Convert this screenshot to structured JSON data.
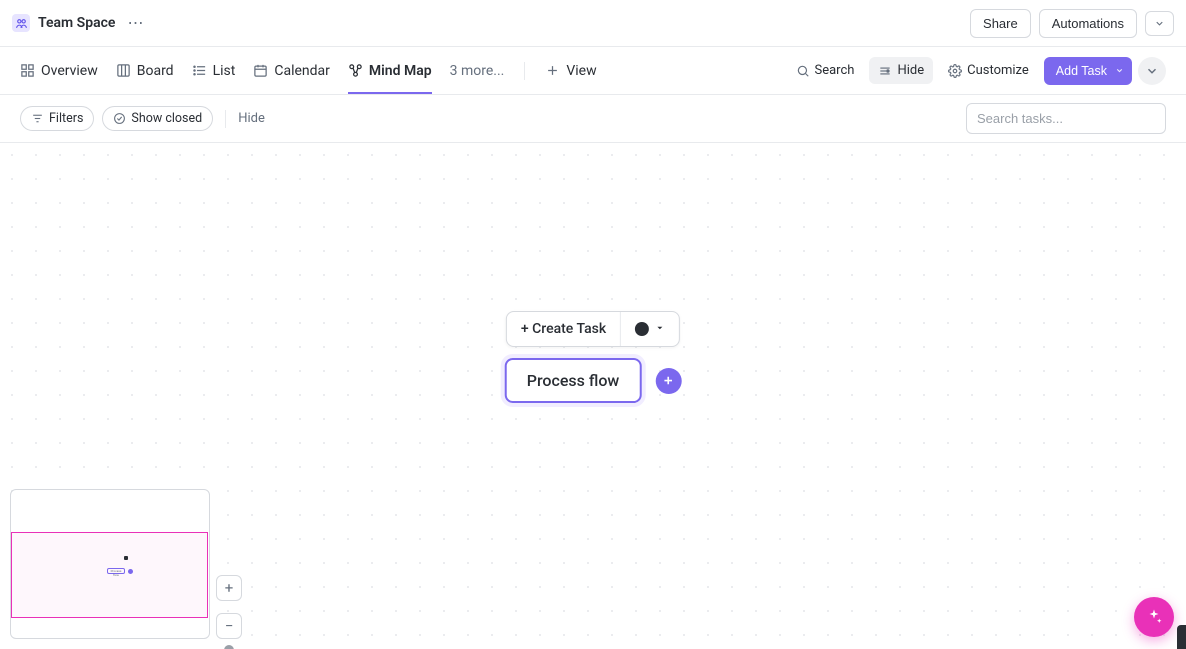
{
  "header": {
    "space_title": "Team Space",
    "share": "Share",
    "automations": "Automations"
  },
  "tabs": {
    "overview": "Overview",
    "board": "Board",
    "list": "List",
    "calendar": "Calendar",
    "mindmap": "Mind Map",
    "more": "3 more...",
    "add_view": "View"
  },
  "view_actions": {
    "search": "Search",
    "hide": "Hide",
    "customize": "Customize",
    "add_task": "Add Task"
  },
  "filters": {
    "filters": "Filters",
    "show_closed": "Show closed",
    "hide": "Hide",
    "search_placeholder": "Search tasks..."
  },
  "canvas": {
    "create_task": "+ Create Task",
    "node_label": "Process flow",
    "minimap_node_label": "Process flow"
  },
  "colors": {
    "accent": "#7b68ee",
    "fab": "#e931b8",
    "minimap_view": "#e931b8"
  }
}
